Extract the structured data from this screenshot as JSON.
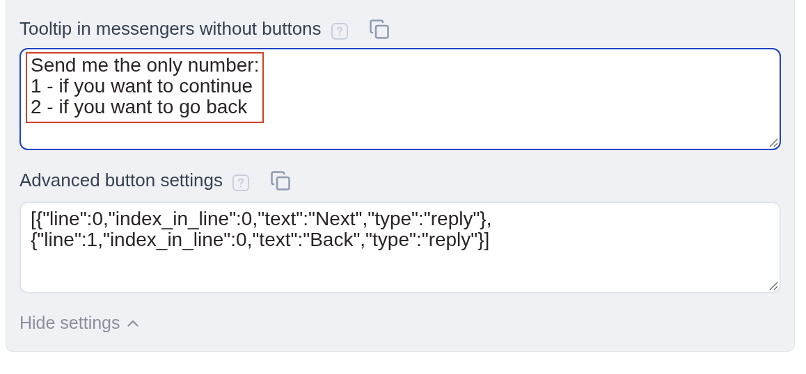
{
  "fields": [
    {
      "label": "Tooltip in messengers without buttons",
      "value": "Send me the only number:\n1 - if you want to continue\n2 - if you want to go back",
      "focused": true,
      "highlighted": true
    },
    {
      "label": "Advanced button settings",
      "value": "[{\"line\":0,\"index_in_line\":0,\"text\":\"Next\",\"type\":\"reply\"},\n{\"line\":1,\"index_in_line\":0,\"text\":\"Back\",\"type\":\"reply\"}]",
      "focused": false,
      "highlighted": false
    }
  ],
  "toggle": {
    "label": "Hide settings",
    "expanded": true
  }
}
